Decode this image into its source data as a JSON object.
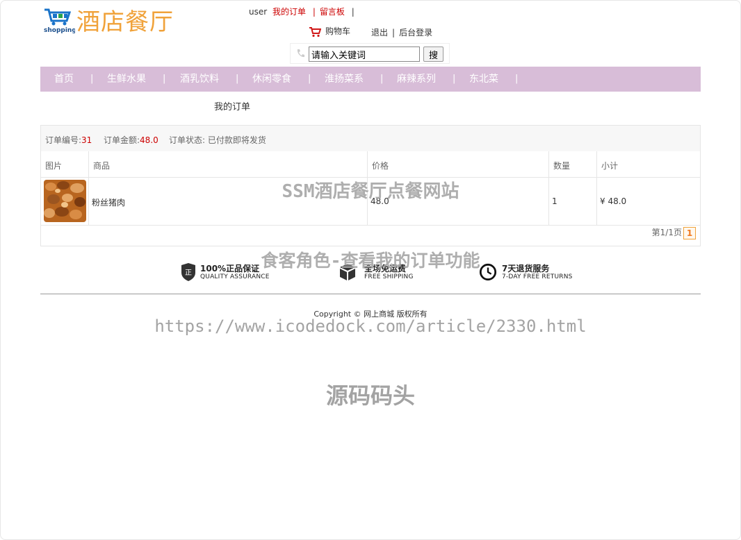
{
  "header": {
    "logo_sub": "shopping",
    "logo_title": "酒店餐厅",
    "username": "user",
    "my_orders": "我的订单",
    "message_board": "留言板",
    "sep": "|",
    "cart": "购物车",
    "logout": "退出",
    "admin_login": "后台登录"
  },
  "search": {
    "value": "请输入关键词",
    "button": "搜"
  },
  "nav": {
    "items": [
      "首页",
      "生鲜水果",
      "酒乳饮料",
      "休闲零食",
      "淮扬菜系",
      "麻辣系列",
      "东北菜"
    ],
    "sep": "|"
  },
  "page": {
    "heading": "我的订单"
  },
  "order": {
    "no_label": "订单编号:",
    "no_value": "31",
    "amount_label": "订单金额:",
    "amount_value": "48.0",
    "status_label": "订单状态:",
    "status_value": "已付款即将发货",
    "columns": [
      "图片",
      "商品",
      "价格",
      "数量",
      "小计"
    ],
    "rows": [
      {
        "product": "粉丝猪肉",
        "price": "48.0",
        "qty": "1",
        "subtotal": "¥ 48.0"
      }
    ],
    "pager_text": "第1/1页",
    "pager_current": "1"
  },
  "guarantees": [
    {
      "title": "100%正品保证",
      "sub": "QUALITY ASSURANCE",
      "icon": "shield-icon"
    },
    {
      "title": "全场免运费",
      "sub": "FREE SHIPPING",
      "icon": "box-icon"
    },
    {
      "title": "7天退货服务",
      "sub": "7-DAY FREE RETURNS",
      "icon": "clock-icon"
    }
  ],
  "footer": {
    "copyright": "Copyright © 网上商城 版权所有"
  },
  "watermarks": {
    "line1": "SSM酒店餐厅点餐网站",
    "line2": "食客角色-查看我的订单功能",
    "line3": "https://www.icodedock.com/article/2330.html",
    "line4": "源码码头"
  },
  "colors": {
    "nav_bg": "#d8bdd8",
    "brand_orange": "#f0a23a",
    "link_red": "#c00000"
  }
}
